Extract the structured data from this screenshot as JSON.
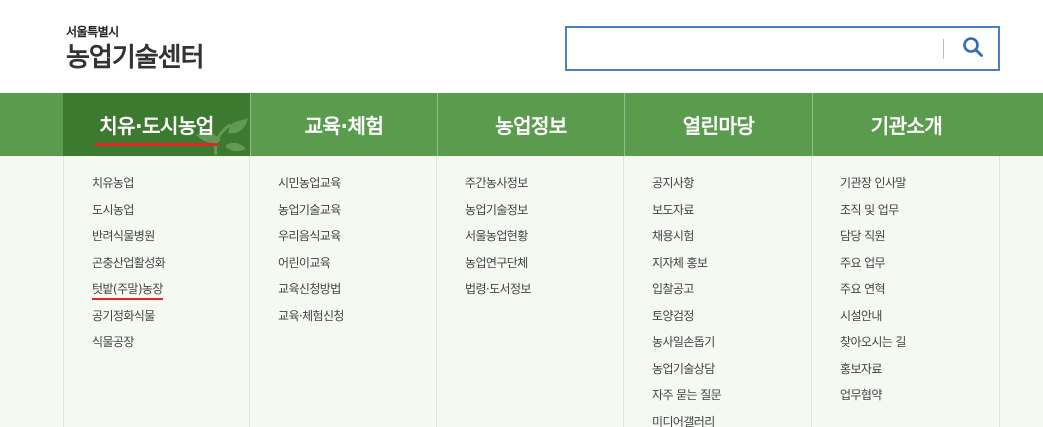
{
  "logo": {
    "sub": "서울특별시",
    "main": "농업기술센터"
  },
  "search": {
    "value": "",
    "placeholder": "",
    "button_icon": "search-icon",
    "accent": "#4a7fc0"
  },
  "colors": {
    "nav_bg": "#5a9b4e",
    "nav_active_bg": "#3c7a2f",
    "highlight": "#e0262b"
  },
  "nav": [
    {
      "label": "치유·도시농업",
      "items": [
        "치유농업",
        "도시농업",
        "반려식물병원",
        "곤충산업활성화",
        "텃밭(주말)농장",
        "공기정화식물",
        "식물공장"
      ]
    },
    {
      "label": "교육·체험",
      "items": [
        "시민농업교육",
        "농업기술교육",
        "우리음식교육",
        "어린이교육",
        "교육신청방법",
        "교육·체험신청"
      ]
    },
    {
      "label": "농업정보",
      "items": [
        "주간농사정보",
        "농업기술정보",
        "서울농업현황",
        "농업연구단체",
        "법령·도서정보"
      ]
    },
    {
      "label": "열린마당",
      "items": [
        "공지사항",
        "보도자료",
        "채용시험",
        "지자체 홍보",
        "입찰공고",
        "토양검정",
        "농사일손돕기",
        "농업기술상담",
        "자주 묻는 질문",
        "미디어갤러리"
      ]
    },
    {
      "label": "기관소개",
      "items": [
        "기관장 인사말",
        "조직 및 업무",
        "담당 직원",
        "주요 업무",
        "주요 연혁",
        "시설안내",
        "찾아오시는 길",
        "홍보자료",
        "업무협약"
      ]
    }
  ]
}
